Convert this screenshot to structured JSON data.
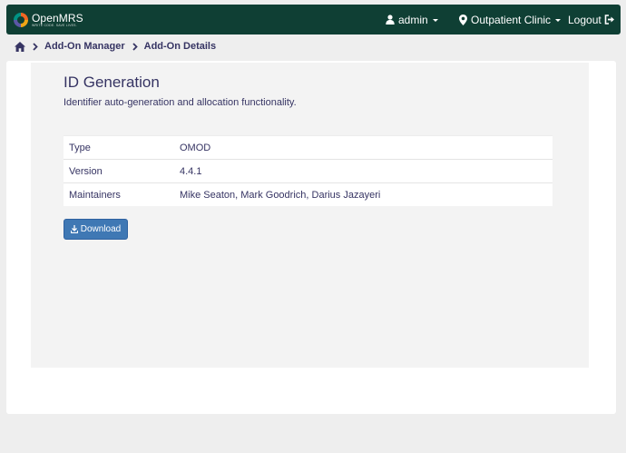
{
  "header": {
    "logo": {
      "name": "OpenMRS",
      "tagline": "WRITE CODE. SAVE LIVES."
    },
    "user": {
      "label": "admin",
      "icon": "user-icon"
    },
    "location": {
      "label": "Outpatient Clinic",
      "icon": "map-marker-icon"
    },
    "logout": {
      "label": "Logout",
      "icon": "sign-out-icon"
    },
    "colors": {
      "background": "#0f3f34"
    }
  },
  "breadcrumb": {
    "home_icon": "home-icon",
    "items": [
      {
        "label": "Add-On Manager"
      },
      {
        "label": "Add-On Details"
      }
    ]
  },
  "addon": {
    "title": "ID Generation",
    "description": "Identifier auto-generation and allocation functionality.",
    "details": [
      {
        "label": "Type",
        "value": "OMOD"
      },
      {
        "label": "Version",
        "value": "4.4.1"
      },
      {
        "label": "Maintainers",
        "value": "Mike Seaton, Mark Goodrich, Darius Jazayeri"
      }
    ],
    "download_label": "Download",
    "download_icon": "download-icon",
    "colors": {
      "button": "#3f78b4"
    }
  }
}
